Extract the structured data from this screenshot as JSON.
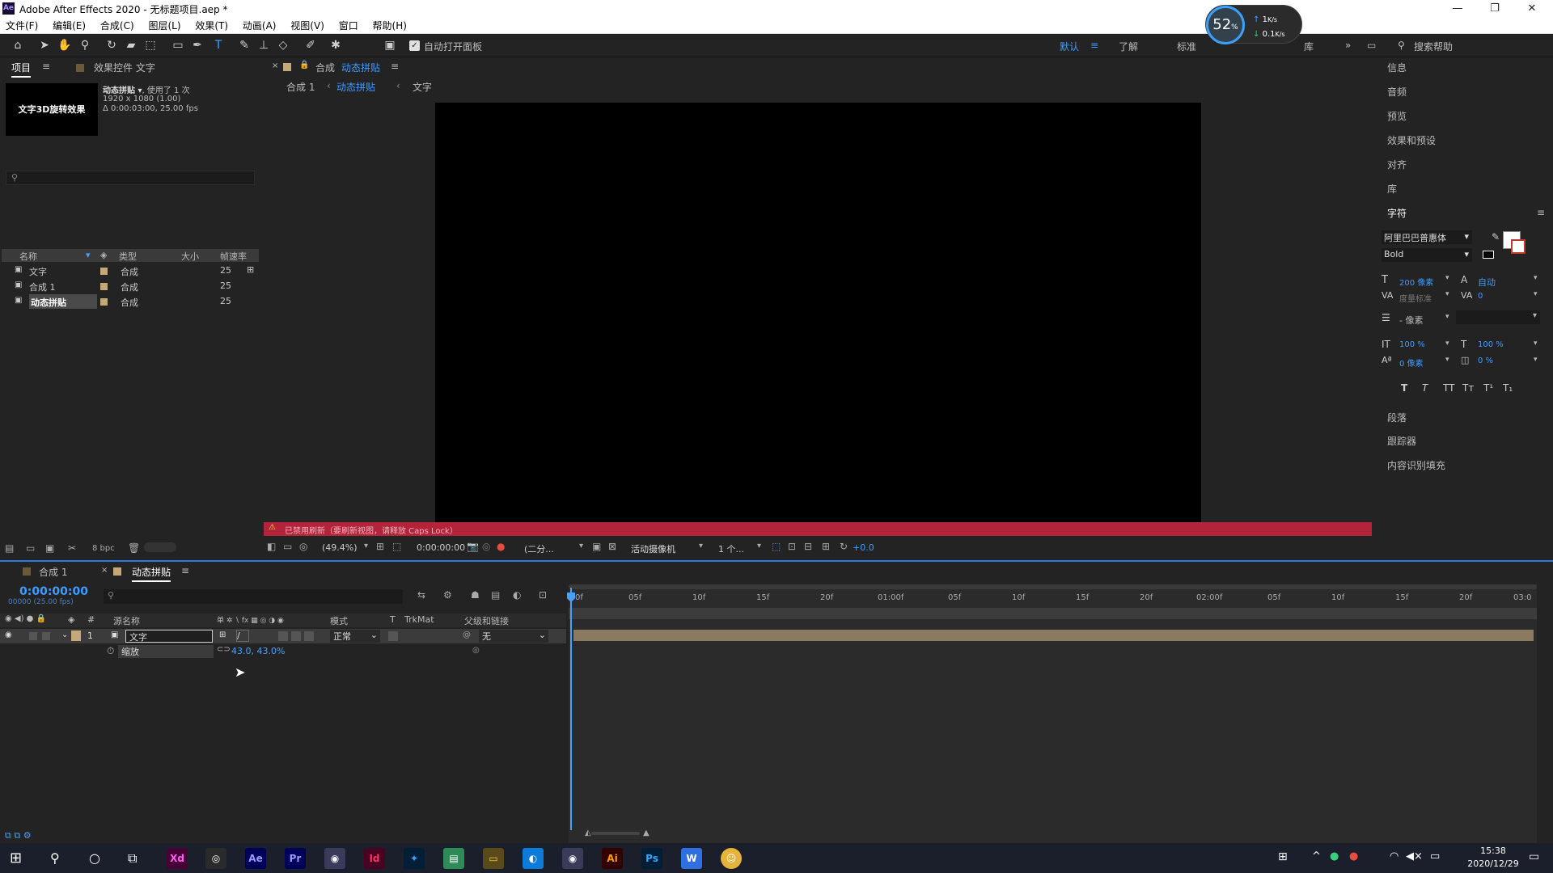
{
  "window": {
    "title": "Adobe After Effects 2020 - 无标题项目.aep *",
    "logo": "Ae"
  },
  "menubar": [
    "文件(F)",
    "编辑(E)",
    "合成(C)",
    "图层(L)",
    "效果(T)",
    "动画(A)",
    "视图(V)",
    "窗口",
    "帮助(H)"
  ],
  "toolbar": {
    "auto_open_label": "自动打开面板",
    "workspaces": [
      "默认",
      "了解",
      "标准",
      "库"
    ],
    "search_help": "搜索帮助",
    "overlay_percent": "52",
    "overlay_percent_sign": "%",
    "net_up": "1",
    "net_down": "0.1",
    "net_unit": "K/s"
  },
  "project": {
    "tab_label": "项目",
    "effects_tab_label": "效果控件 文字",
    "thumbnail_text": "文字3D旋转效果",
    "comp_name": "动态拼贴",
    "used_text": ", 使用了 1 次",
    "resolution": "1920 x 1080 (1.00)",
    "duration": "Δ 0:00:03:00, 25.00 fps",
    "columns": [
      "名称",
      "类型",
      "大小",
      "帧速率"
    ],
    "items": [
      {
        "name": "文字",
        "type": "合成",
        "fps": "25"
      },
      {
        "name": "合成 1",
        "type": "合成",
        "fps": "25"
      },
      {
        "name": "动态拼贴",
        "type": "合成",
        "fps": "25"
      }
    ],
    "bpc": "8 bpc"
  },
  "viewer": {
    "tab_prefix": "合成",
    "tab_label": "动态拼贴",
    "breadcrumbs": [
      "合成 1",
      "动态拼贴",
      "文字"
    ],
    "warning": "已禁用刷新（要刷新视图，请释放 Caps Lock）",
    "zoom": "(49.4%)",
    "timecode": "0:00:00:00",
    "resolution": "(二分...",
    "camera": "活动摄像机",
    "views": "1 个...",
    "exposure": "+0.0"
  },
  "right_panel": {
    "items": [
      "信息",
      "音频",
      "预览",
      "效果和预设",
      "对齐",
      "库"
    ],
    "character_title": "字符",
    "font_family": "阿里巴巴普惠体",
    "font_style": "Bold",
    "font_size": "200 像素",
    "leading": "自动",
    "kerning": "度量标准",
    "tracking": "0",
    "stroke": "- 像素",
    "vscale": "100 %",
    "hscale": "100 %",
    "baseline": "0 像素",
    "tsume": "0 %",
    "style_buttons": [
      "T",
      "T",
      "TT",
      "Tт",
      "T¹",
      "T₁"
    ],
    "bottom_items": [
      "段落",
      "跟踪器",
      "内容识别填充"
    ]
  },
  "timeline": {
    "tabs": [
      "合成 1",
      "动态拼贴"
    ],
    "timecode": "0:00:00:00",
    "frame_info": "00000 (25.00 fps)",
    "columns": [
      "源名称",
      "模式",
      "T",
      "TrkMat",
      "父级和链接"
    ],
    "layer": {
      "index": "1",
      "name": "文字",
      "mode": "正常",
      "parent": "无"
    },
    "property": {
      "name": "缩放",
      "value": "43.0, 43.0%"
    },
    "ruler": [
      "0f",
      "05f",
      "10f",
      "15f",
      "20f",
      "01:00f",
      "05f",
      "10f",
      "15f",
      "20f",
      "02:00f",
      "05f",
      "10f",
      "15f",
      "20f",
      "03:0"
    ]
  },
  "taskbar": {
    "apps": [
      {
        "name": "Xd",
        "color": "#ff61f6",
        "bg": "#470137"
      },
      {
        "name": "",
        "color": "#ffffff",
        "bg": "#2a2a2a"
      },
      {
        "name": "Ae",
        "color": "#9999ff",
        "bg": "#00005b"
      },
      {
        "name": "Pr",
        "color": "#9999ff",
        "bg": "#00005b"
      },
      {
        "name": "",
        "color": "#ffffff",
        "bg": "#3a3a5a"
      },
      {
        "name": "Id",
        "color": "#ff3366",
        "bg": "#49021f"
      },
      {
        "name": "",
        "color": "#31a8ff",
        "bg": "#001e36"
      },
      {
        "name": "",
        "color": "#ffffff",
        "bg": "#2e8b57"
      },
      {
        "name": "",
        "color": "#f5c542",
        "bg": "#5a4a1a"
      },
      {
        "name": "",
        "color": "#ffffff",
        "bg": "#0c7bd9"
      },
      {
        "name": "",
        "color": "#ffffff",
        "bg": "#3a3a5a"
      },
      {
        "name": "Ai",
        "color": "#ff9a00",
        "bg": "#330000"
      },
      {
        "name": "Ps",
        "color": "#31a8ff",
        "bg": "#001e36"
      },
      {
        "name": "",
        "color": "#ffffff",
        "bg": "#2f6fe0"
      },
      {
        "name": "",
        "color": "#ffffff",
        "bg": "#e8b33a"
      }
    ],
    "time": "15:38",
    "date": "2020/12/29"
  }
}
